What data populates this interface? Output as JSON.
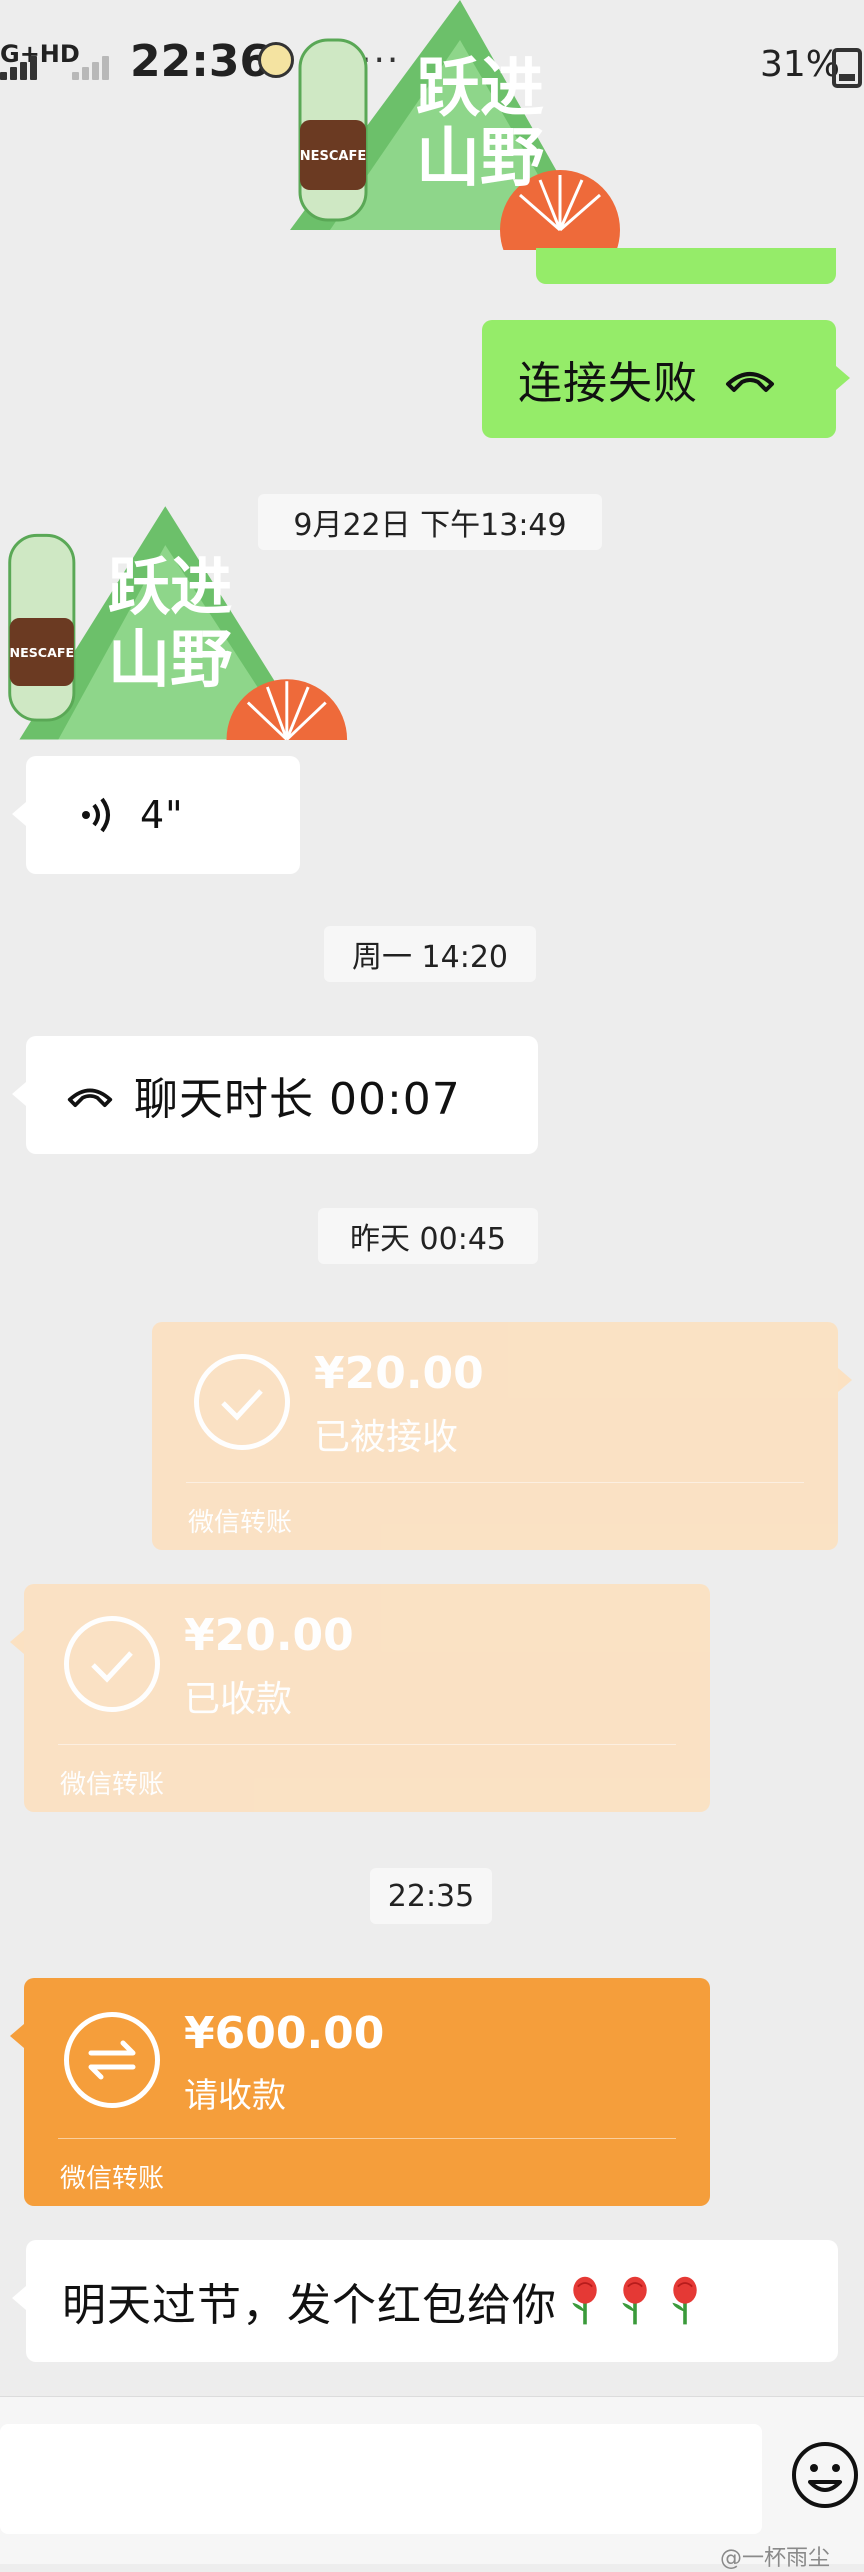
{
  "status_bar": {
    "network": "G+HD",
    "time": "22:36",
    "battery": "31%"
  },
  "messages": {
    "call_failed": "连接失败",
    "timestamp_1": "9月22日 下午13:49",
    "voice_duration": "4\"",
    "timestamp_2": "周一 14:20",
    "call_duration": "聊天时长 00:07",
    "timestamp_3": "昨天 00:45",
    "transfer_1": {
      "amount": "¥20.00",
      "status": "已被接收",
      "footer": "微信转账"
    },
    "transfer_2": {
      "amount": "¥20.00",
      "status": "已收款",
      "footer": "微信转账"
    },
    "timestamp_4": "22:35",
    "transfer_3": {
      "amount": "¥600.00",
      "status": "请收款",
      "footer": "微信转账"
    },
    "last_message": "明天过节，发个红包给你"
  },
  "sticker": {
    "brand": "NESCAFE",
    "slogan": "跃进山野"
  },
  "watermark": "@一杯雨尘",
  "colors": {
    "background": "#ededed",
    "sent_bubble": "#95ec69",
    "received_bubble": "#ffffff",
    "transfer_done": "#fbe1c2",
    "transfer_pending": "#f59e3b"
  }
}
